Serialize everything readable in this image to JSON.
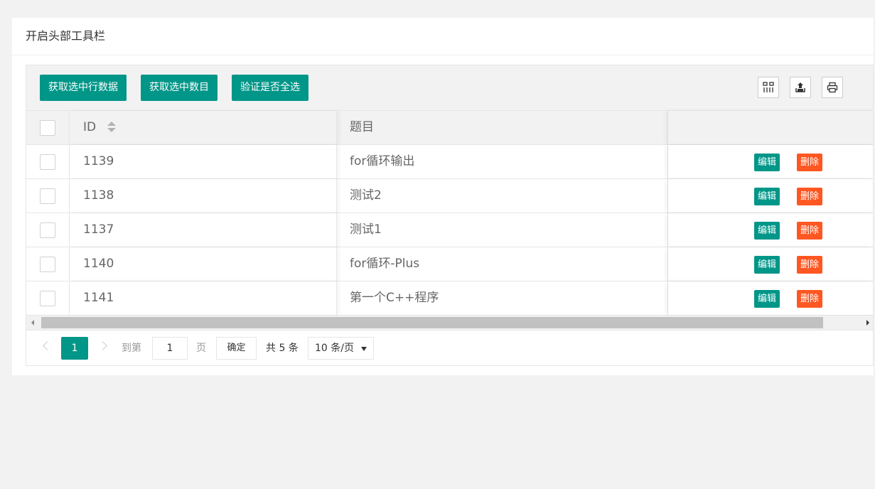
{
  "card": {
    "title": "开启头部工具栏"
  },
  "toolbar": {
    "buttons": [
      "获取选中行数据",
      "获取选中数目",
      "验证是否全选"
    ],
    "icons": [
      "columns-filter-icon",
      "export-icon",
      "print-icon"
    ]
  },
  "table": {
    "headers": {
      "id": "ID",
      "title": "题目",
      "ops": ""
    },
    "rows": [
      {
        "id": "1139",
        "title": "for循环输出"
      },
      {
        "id": "1138",
        "title": "测试2"
      },
      {
        "id": "1137",
        "title": "测试1"
      },
      {
        "id": "1140",
        "title": "for循环-Plus"
      },
      {
        "id": "1141",
        "title": "第一个C++程序"
      }
    ],
    "edit_label": "编辑",
    "delete_label": "删除"
  },
  "pager": {
    "current_page": "1",
    "goto_prefix": "到第",
    "goto_value": "1",
    "goto_suffix": "页",
    "confirm_label": "确定",
    "total_label": "共 5 条",
    "page_size": "10 条/页"
  },
  "colors": {
    "primary": "#009688",
    "danger": "#ff5722"
  }
}
